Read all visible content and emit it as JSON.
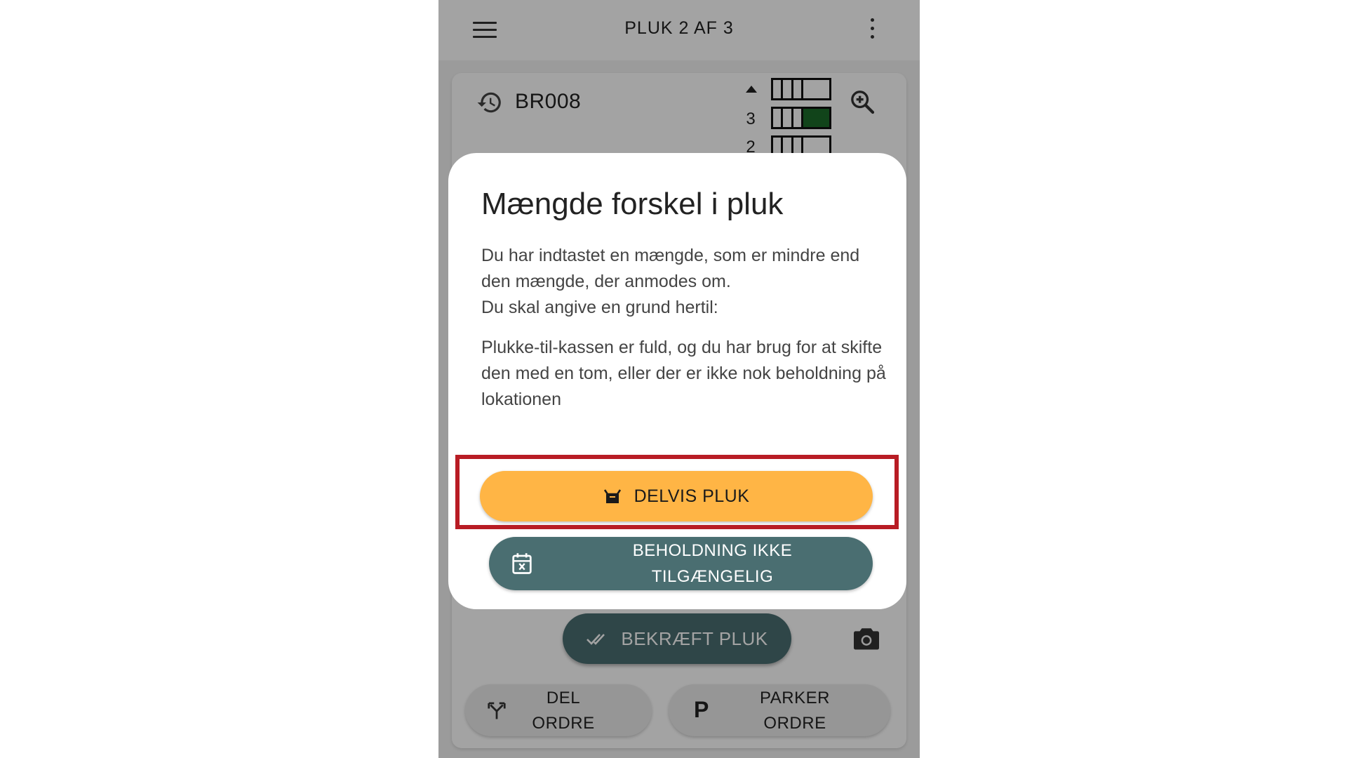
{
  "header": {
    "title": "PLUK 2 AF 3"
  },
  "location": {
    "code": "BR008",
    "levels": [
      "3",
      "2"
    ]
  },
  "dialog": {
    "title": "Mængde forskel i pluk",
    "paragraph1": "Du har indtastet en mængde, som er mindre end den mængde, der anmodes om.",
    "paragraph2": "Du skal angive en grund hertil:",
    "paragraph3": "Plukke-til-kassen er fuld, og du har brug for at skifte den med en tom, eller der er ikke nok beholdning på lokationen",
    "partial_pick_label": "DELVIS PLUK",
    "stock_unavailable_label": "BEHOLDNING IKKE\nTILGÆNGELIG"
  },
  "actions": {
    "confirm_label": "BEKRÆFT PLUK",
    "split_order_label": "DEL\nORDRE",
    "park_symbol": "P",
    "park_order_label": "PARKER\nORDRE"
  },
  "colors": {
    "accent_orange": "#ffb545",
    "teal": "#4a6e71",
    "highlight_red": "#b81c24",
    "shelf_active": "#1c6b2a"
  },
  "icons": {
    "menu": "menu-icon",
    "more": "more-vertical-icon",
    "history": "history-icon",
    "zoom": "zoom-in-icon",
    "basket": "basket-icon",
    "calendar": "calendar-x-icon",
    "check": "double-check-icon",
    "camera": "camera-icon",
    "split": "split-icon"
  }
}
